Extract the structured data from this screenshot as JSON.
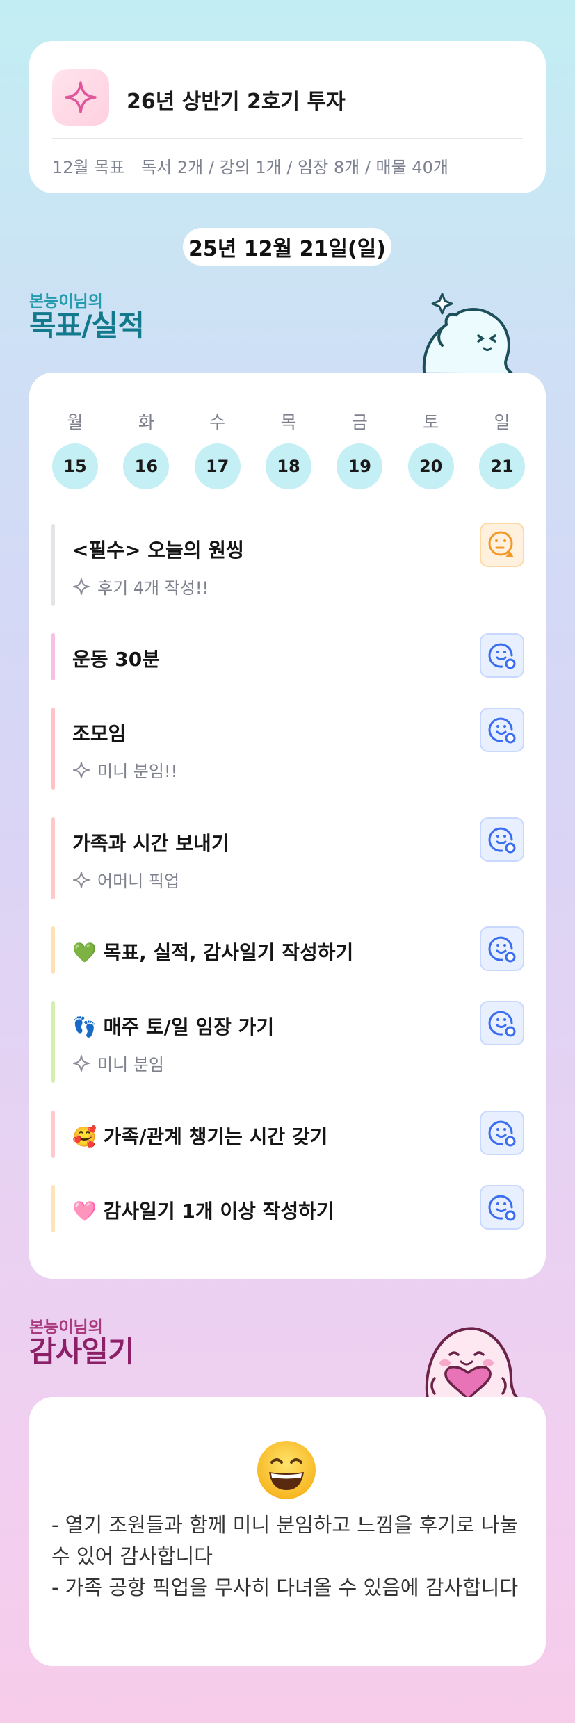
{
  "top_card": {
    "title": "26년 상반기 2호기 투자",
    "goal_label": "12월 목표",
    "goal_text": "독서 2개 / 강의 1개 / 임장 8개 / 매물 40개",
    "icon": "sparkle-icon",
    "accent": "#e0569a"
  },
  "date": "25년 12월 21일(일)",
  "goals_section": {
    "subtitle": "본능이님의",
    "title": "목표/실적"
  },
  "week": [
    {
      "dow": "월",
      "date": "15"
    },
    {
      "dow": "화",
      "date": "16"
    },
    {
      "dow": "수",
      "date": "17"
    },
    {
      "dow": "목",
      "date": "18"
    },
    {
      "dow": "금",
      "date": "19"
    },
    {
      "dow": "토",
      "date": "20"
    },
    {
      "dow": "일",
      "date": "21"
    }
  ],
  "goals": [
    {
      "title": "<필수> 오늘의 원씽",
      "sub": "후기 4개 작성!!",
      "bar_color": "#e4e4e8",
      "status": "warning"
    },
    {
      "title": "운동 30분",
      "sub": "",
      "bar_color": "#f7bfe3",
      "status": "done"
    },
    {
      "title": "조모임",
      "sub": "미니 분임!!",
      "bar_color": "#ffc2c7",
      "status": "done"
    },
    {
      "title": "가족과 시간 보내기",
      "sub": "어머니 픽업",
      "bar_color": "#ffc9c9",
      "status": "done"
    },
    {
      "title": "💚 목표, 실적, 감사일기 작성하기",
      "sub": "",
      "bar_color": "#ffe1b5",
      "status": "done"
    },
    {
      "title": "👣 매주 토/일 임장 가기",
      "sub": "미니 분임",
      "bar_color": "#d5efb0",
      "status": "done"
    },
    {
      "title": "🥰 가족/관계 챙기는 시간 갖기",
      "sub": "",
      "bar_color": "#ffc9cf",
      "status": "done"
    },
    {
      "title": "🩷 감사일기 1개 이상 작성하기",
      "sub": "",
      "bar_color": "#ffe3bb",
      "status": "done"
    }
  ],
  "gratitude_section": {
    "subtitle": "본능이님의",
    "title": "감사일기"
  },
  "gratitude": {
    "emoji": "grinning-face-icon",
    "lines": [
      "- 열기 조원들과 함께 미니 분임하고 느낌을 후기로 나눌 수 있어 감사합니다",
      "- 가족 공항 픽업을 무사히 다녀올 수 있음에 감사합니다"
    ]
  }
}
